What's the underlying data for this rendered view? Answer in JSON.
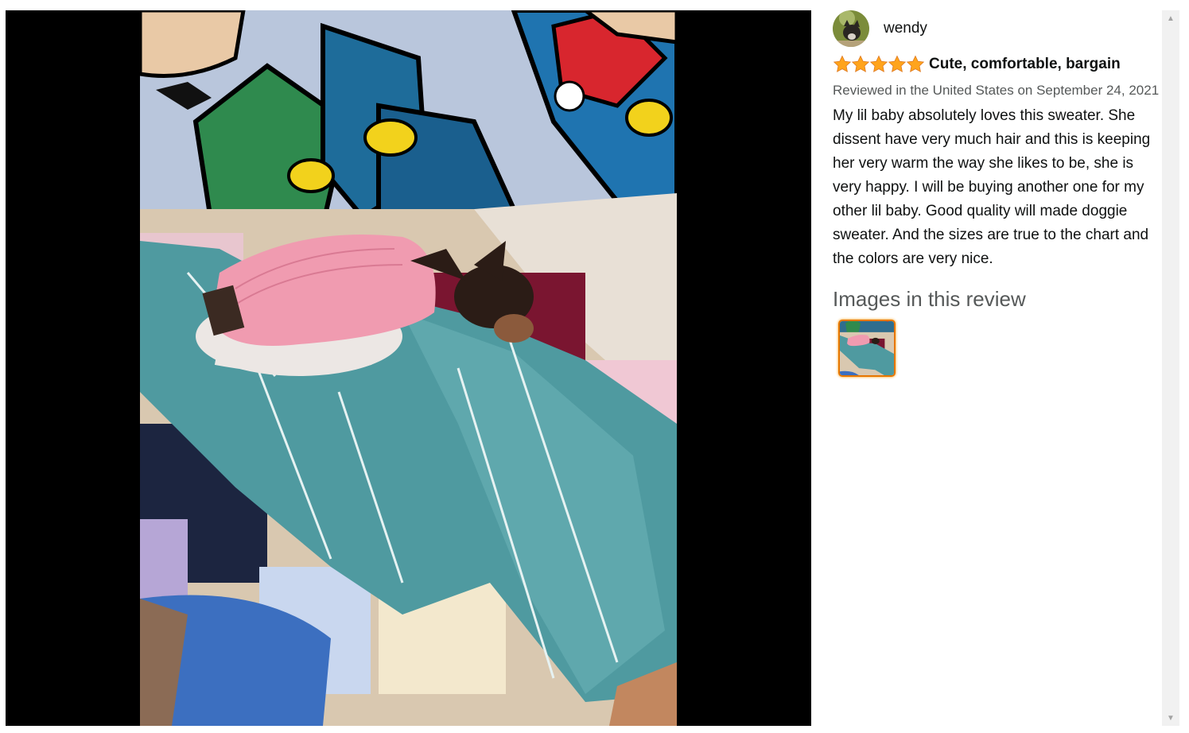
{
  "review": {
    "author_name": "wendy",
    "rating": 5,
    "max_rating": 5,
    "title": "Cute, comfortable, bargain",
    "date": "Reviewed in the United States on September 24, 2021",
    "body": "My lil baby absolutely loves this sweater. She dissent have very much hair and this is keeping her very warm the way she likes to be, she is very happy. I will be buying another one for my other lil baby. Good quality will made doggie sweater. And the sizes are true to the chart and the colors are very nice.",
    "images_heading": "Images in this review"
  },
  "icons": {
    "star": "star-icon",
    "scroll_up": "arrow-up-icon",
    "scroll_down": "arrow-down-icon"
  },
  "colors": {
    "star": "#ffa41c",
    "thumb_selected_border": "#e77600",
    "secondary_text": "#565959",
    "viewer_bg": "#000000"
  },
  "scrollbar": {
    "up_glyph": "▲",
    "down_glyph": "▼"
  }
}
